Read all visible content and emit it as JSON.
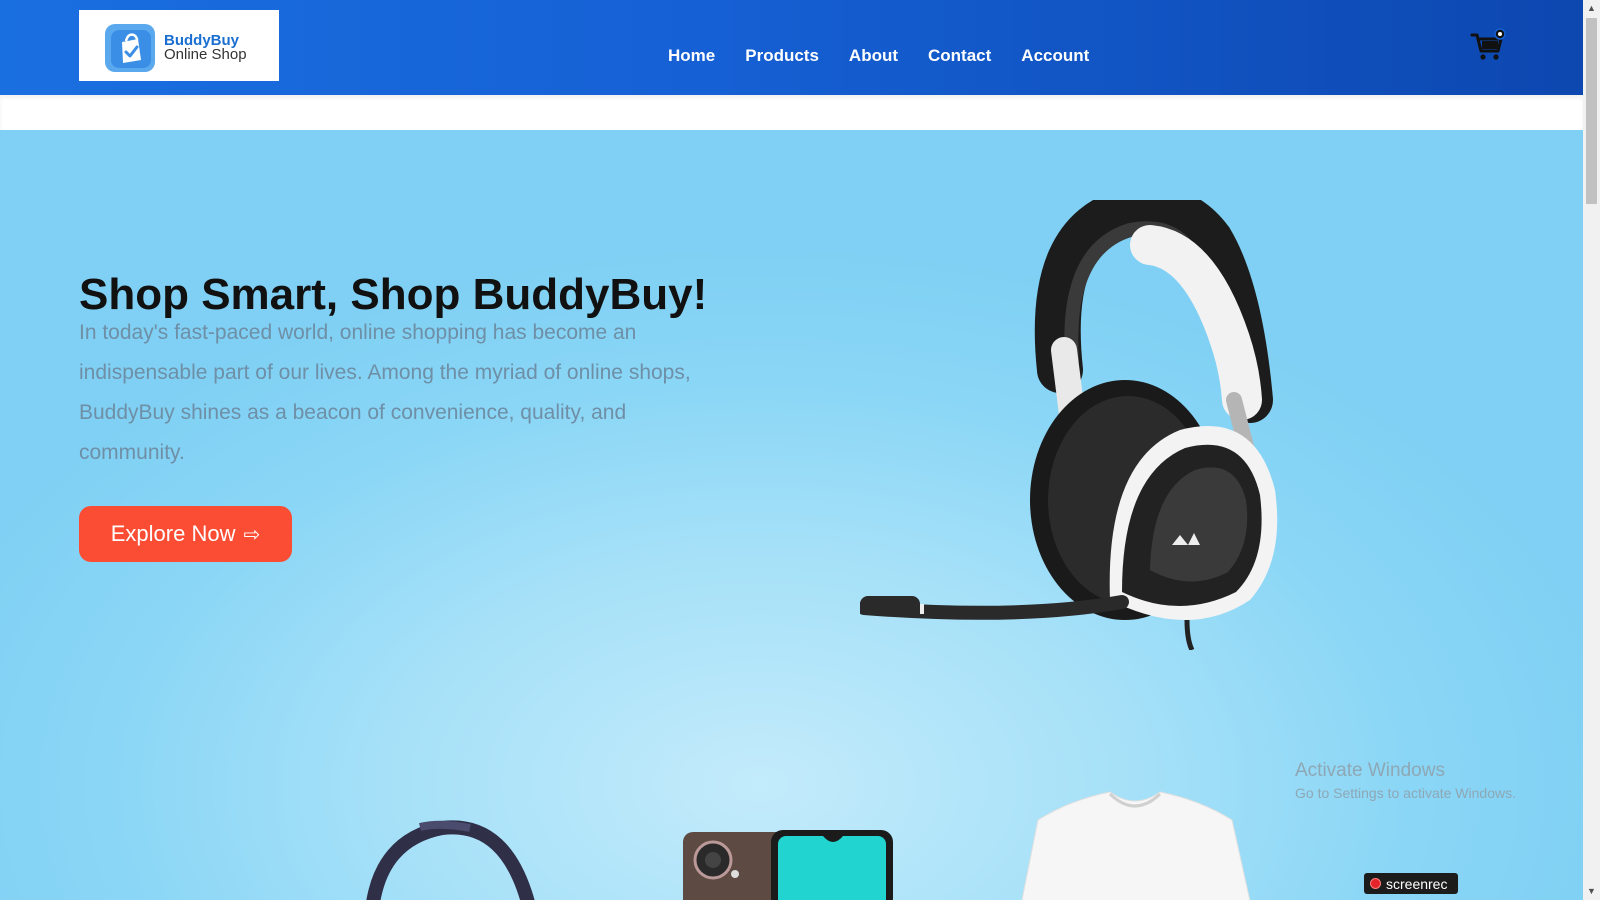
{
  "brand": {
    "name": "BuddyBuy",
    "tagline": "Online Shop"
  },
  "nav": {
    "items": [
      "Home",
      "Products",
      "About",
      "Contact",
      "Account"
    ]
  },
  "hero": {
    "title": "Shop Smart, Shop BuddyBuy!",
    "body": "In today's fast-paced world, online shopping has become an indispensable part of our lives. Among the myriad of online shops, BuddyBuy shines as a beacon of convenience, quality, and community.",
    "cta_label": "Explore Now",
    "cta_arrow": "⇨"
  },
  "overlay": {
    "activate_title": "Activate Windows",
    "activate_sub": "Go to Settings to activate Windows.",
    "recorder": "screenrec"
  },
  "icons": {
    "cart": "cart-icon",
    "logo": "shopping-bag-check-icon"
  },
  "colors": {
    "header_blue": "#1560d4",
    "cta_red": "#fb4c34",
    "hero_sky": "#8ad6f6",
    "body_text": "#6e8fa6"
  }
}
